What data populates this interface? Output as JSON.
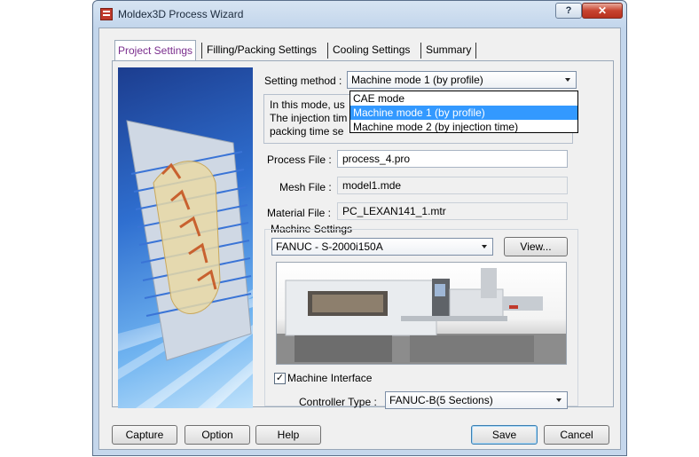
{
  "window": {
    "title": "Moldex3D Process Wizard",
    "help_label": "?",
    "close_label": "✕"
  },
  "tabs": [
    {
      "label": "Project Settings"
    },
    {
      "label": "Filling/Packing Settings"
    },
    {
      "label": "Cooling Settings"
    },
    {
      "label": "Summary"
    }
  ],
  "setting_method": {
    "label": "Setting method :",
    "selected": "Machine mode 1 (by profile)",
    "options": [
      "CAE mode",
      "Machine mode 1 (by profile)",
      "Machine mode 2 (by injection time)"
    ],
    "highlighted_index": 1
  },
  "description": {
    "line1": "In this mode, us",
    "line2": "The injection tim",
    "line3": "packing time se"
  },
  "process_file": {
    "label": "Process File :",
    "value": "process_4.pro"
  },
  "mesh_file": {
    "label": "Mesh File :",
    "value": "model1.mde"
  },
  "material_file": {
    "label": "Material File :",
    "value": "PC_LEXAN141_1.mtr"
  },
  "machine_settings": {
    "label": "Machine Settings",
    "machine": "FANUC - S-2000i150A",
    "view_label": "View..."
  },
  "machine_interface": {
    "label": "Machine Interface",
    "checked": true
  },
  "controller_type": {
    "label": "Controller Type :",
    "value": "FANUC-B(5 Sections)"
  },
  "buttons": {
    "capture": "Capture",
    "option": "Option",
    "help": "Help",
    "save": "Save",
    "cancel": "Cancel"
  },
  "icons": {
    "app": "moldex3d-app-icon",
    "dropdown": "chevron-down-icon",
    "checkbox": "checkbox-checked-icon"
  },
  "colors": {
    "active_tab_text": "#7a2d8d",
    "selection": "#3399ff",
    "close_button": "#c7432f"
  }
}
